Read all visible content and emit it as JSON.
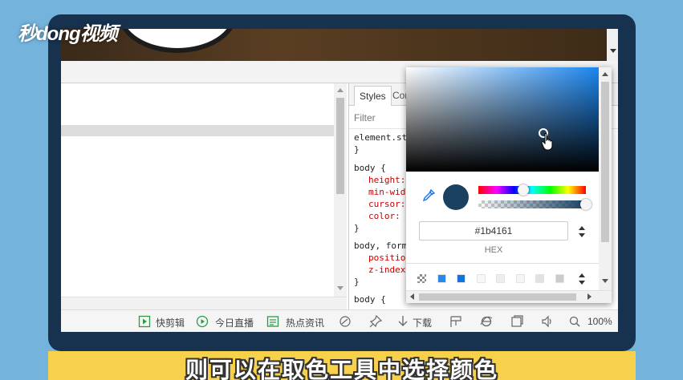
{
  "watermark": "秒dong视频",
  "devtools": {
    "tabs": [
      "Styles",
      "Com"
    ],
    "filter_label": "Filter",
    "rules": [
      {
        "selector": "element.st",
        "props": [],
        "close": "}"
      },
      {
        "selector": "body {",
        "props": [
          "height:",
          "min-wid",
          "cursor:",
          "color:"
        ],
        "close": "}"
      },
      {
        "selector": "body, form",
        "props": [
          "positio",
          "z-index"
        ],
        "close": "}"
      },
      {
        "selector": "body {",
        "props": [],
        "close": ""
      }
    ]
  },
  "color_picker": {
    "hex_value": "#1b4161",
    "format_label": "HEX",
    "current_color": "#1b4161",
    "hue_color": "#1c86ee",
    "hue_fraction": 0.42,
    "alpha_fraction": 1.0,
    "swatches": [
      "#8a8a8a",
      "#2b88e8",
      "#1572d8",
      "#f7f7f7",
      "#eeeeee",
      "#f5f5f5",
      "#e2e2e2",
      "#cccccc"
    ]
  },
  "statusbar": {
    "items": [
      {
        "label": "快剪辑",
        "icon": "video-edit-icon"
      },
      {
        "label": "今日直播",
        "icon": "play-circle-icon"
      },
      {
        "label": "热点资讯",
        "icon": "news-icon"
      }
    ],
    "download_label": "下载",
    "zoom_label": "100%"
  },
  "caption": "则可以在取色工具中选择颜色"
}
